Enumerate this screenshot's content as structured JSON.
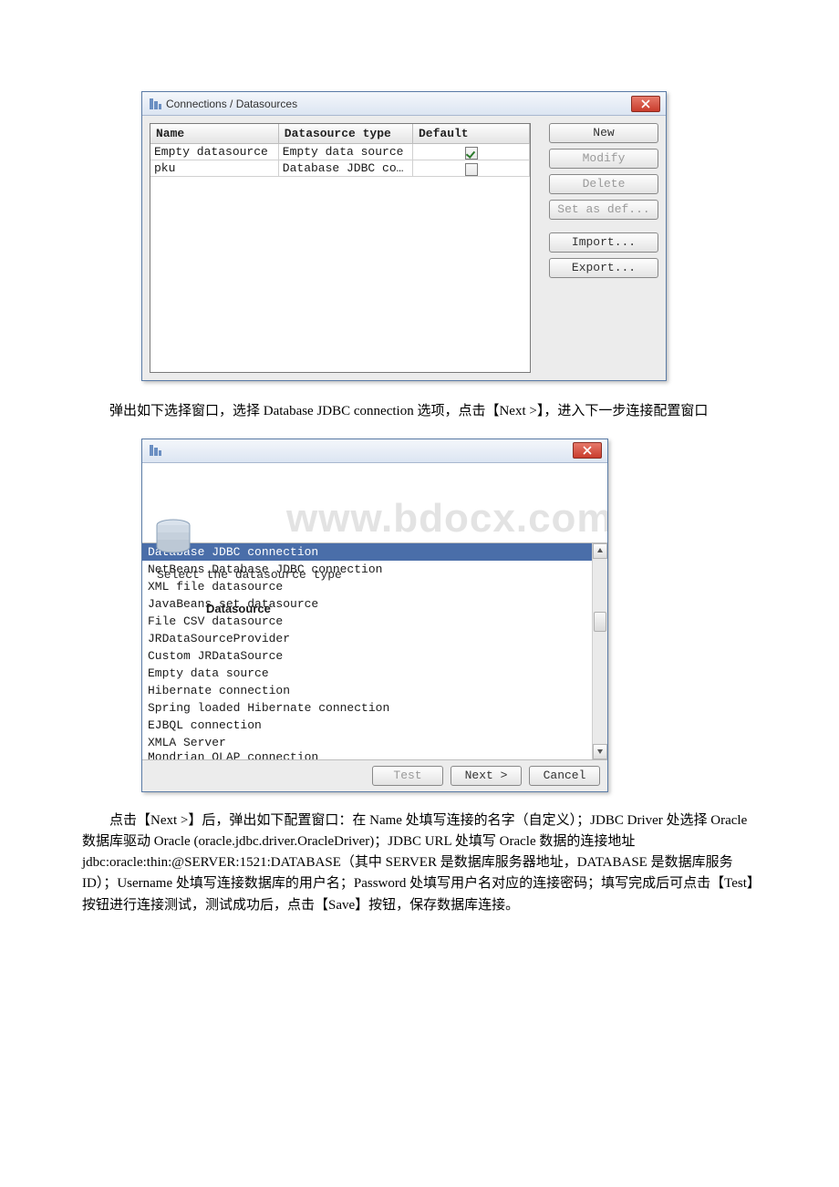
{
  "dialog1": {
    "title": "Connections / Datasources",
    "headers": {
      "name": "Name",
      "type": "Datasource type",
      "def": "Default"
    },
    "rows": [
      {
        "name": "Empty datasource",
        "type": "Empty data source",
        "def": true
      },
      {
        "name": "pku",
        "type": "Database JDBC co...",
        "def": false
      }
    ],
    "buttons": {
      "new": "New",
      "modify": "Modify",
      "delete": "Delete",
      "setdef": "Set as def...",
      "import": "Import...",
      "export": "Export..."
    }
  },
  "para1": "弹出如下选择窗口，选择 Database JDBC connection 选项，点击【Next >】，进入下一步连接配置窗口",
  "dialog2": {
    "headerTitle": "Datasource",
    "headerSub": "Select the datasource type",
    "watermark": "www.bdocx.com",
    "items": [
      "Database JDBC connection",
      "NetBeans Database JDBC connection",
      "XML file datasource",
      "JavaBeans set datasource",
      "File CSV datasource",
      "JRDataSourceProvider",
      "Custom JRDataSource",
      "Empty data source",
      "Hibernate connection",
      "Spring loaded Hibernate connection",
      "EJBQL connection",
      "XMLA Server",
      "Mondrian OLAP connection"
    ],
    "selectedIndex": 0,
    "buttons": {
      "test": "Test",
      "next": "Next >",
      "cancel": "Cancel"
    }
  },
  "para2": "点击【Next >】后，弹出如下配置窗口：在 Name 处填写连接的名字（自定义）；JDBC Driver 处选择 Oracle 数据库驱动 Oracle (oracle.jdbc.driver.OracleDriver)；JDBC URL 处填写 Oracle 数据的连接地址 jdbc:oracle:thin:@SERVER:1521:DATABASE（其中 SERVER 是数据库服务器地址，DATABASE 是数据库服务 ID）；Username 处填写连接数据库的用户名；Password 处填写用户名对应的连接密码；填写完成后可点击【Test】按钮进行连接测试，测试成功后，点击【Save】按钮，保存数据库连接。"
}
